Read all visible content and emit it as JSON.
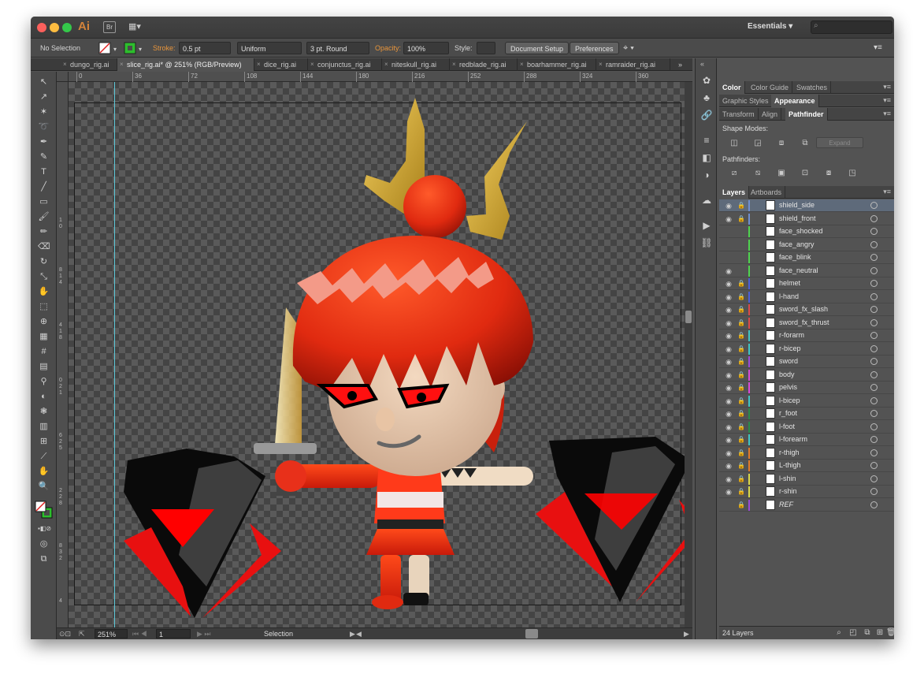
{
  "app": {
    "logo": "Ai",
    "bridge": "Br",
    "layout_icon": "▦▾",
    "workspace": "Essentials ▾",
    "search_placeholder": ""
  },
  "control": {
    "selection": "No Selection",
    "stroke_label": "Stroke:",
    "stroke_value": "0.5 pt",
    "uniform": "Uniform",
    "brush": "3 pt. Round",
    "opacity_label": "Opacity:",
    "opacity_value": "100%",
    "style_label": "Style:",
    "doc_setup": "Document Setup",
    "preferences": "Preferences"
  },
  "tabs": [
    {
      "label": "dungo_rig.ai",
      "active": false
    },
    {
      "label": "slice_rig.ai* @ 251% (RGB/Preview)",
      "active": true
    },
    {
      "label": "dice_rig.ai",
      "active": false
    },
    {
      "label": "conjunctus_rig.ai",
      "active": false
    },
    {
      "label": "niteskull_rig.ai",
      "active": false
    },
    {
      "label": "redblade_rig.ai",
      "active": false
    },
    {
      "label": "boarhammer_rig.ai",
      "active": false
    },
    {
      "label": "ramraider_rig.ai",
      "active": false
    }
  ],
  "ruler": {
    "h_ticks": [
      "0",
      "36",
      "72",
      "108",
      "144",
      "180",
      "216",
      "252",
      "288",
      "324",
      "360"
    ],
    "v_ticks": [
      "1",
      "0",
      "8",
      "1",
      "4",
      "4",
      "1",
      "8",
      "0",
      "2",
      "1",
      "6",
      "2",
      "5",
      "2",
      "2",
      "8",
      "8",
      "3",
      "2",
      "4"
    ]
  },
  "status": {
    "zoom": "251%",
    "page": "1",
    "mode": "Selection"
  },
  "panels": {
    "group1_tabs": [
      "Color",
      "Color Guide",
      "Swatches"
    ],
    "group2_tabs": [
      "Graphic Styles",
      "Appearance"
    ],
    "group3_tabs": [
      "Transform",
      "Align",
      "Pathfinder"
    ],
    "shape_modes": "Shape Modes:",
    "pathfinders": "Pathfinders:",
    "expand": "Expand",
    "layers_tabs": [
      "Layers",
      "Artboards"
    ],
    "layer_count": "24 Layers"
  },
  "layers": [
    {
      "name": "shield_side",
      "color": "#6f8fd0",
      "eye": true,
      "lock": true,
      "selected": true
    },
    {
      "name": "shield_front",
      "color": "#6f8fd0",
      "eye": true,
      "lock": true,
      "selected": false
    },
    {
      "name": "face_shocked",
      "color": "#4fd34f",
      "eye": false,
      "lock": false,
      "selected": false
    },
    {
      "name": "face_angry",
      "color": "#4fd34f",
      "eye": false,
      "lock": false,
      "selected": false
    },
    {
      "name": "face_blink",
      "color": "#4fd34f",
      "eye": false,
      "lock": false,
      "selected": false
    },
    {
      "name": "face_neutral",
      "color": "#4fd34f",
      "eye": true,
      "lock": false,
      "selected": false
    },
    {
      "name": "helmet",
      "color": "#4a5fd8",
      "eye": true,
      "lock": true,
      "selected": false
    },
    {
      "name": "l-hand",
      "color": "#4a5fd8",
      "eye": true,
      "lock": true,
      "selected": false
    },
    {
      "name": "sword_fx_slash",
      "color": "#d84a4a",
      "eye": true,
      "lock": true,
      "selected": false
    },
    {
      "name": "sword_fx_thrust",
      "color": "#d84a4a",
      "eye": true,
      "lock": true,
      "selected": false
    },
    {
      "name": "r-forarm",
      "color": "#3fc4c4",
      "eye": true,
      "lock": true,
      "selected": false
    },
    {
      "name": "r-bicep",
      "color": "#3fc4c4",
      "eye": true,
      "lock": true,
      "selected": false
    },
    {
      "name": "sword",
      "color": "#9a4ad8",
      "eye": true,
      "lock": true,
      "selected": false
    },
    {
      "name": "body",
      "color": "#d84ad8",
      "eye": true,
      "lock": true,
      "selected": false
    },
    {
      "name": "pelvis",
      "color": "#d84ad8",
      "eye": true,
      "lock": true,
      "selected": false
    },
    {
      "name": "l-bicep",
      "color": "#3fc4c4",
      "eye": true,
      "lock": true,
      "selected": false
    },
    {
      "name": "r_foot",
      "color": "#2a8a4a",
      "eye": true,
      "lock": true,
      "selected": false
    },
    {
      "name": "l-foot",
      "color": "#2a8a4a",
      "eye": true,
      "lock": true,
      "selected": false
    },
    {
      "name": "l-forearm",
      "color": "#3fc4c4",
      "eye": true,
      "lock": true,
      "selected": false
    },
    {
      "name": "r-thigh",
      "color": "#e07a2a",
      "eye": true,
      "lock": true,
      "selected": false
    },
    {
      "name": "L-thigh",
      "color": "#e07a2a",
      "eye": true,
      "lock": true,
      "selected": false
    },
    {
      "name": "l-shin",
      "color": "#d8d84a",
      "eye": true,
      "lock": true,
      "selected": false
    },
    {
      "name": "r-shin",
      "color": "#d8d84a",
      "eye": true,
      "lock": true,
      "selected": false
    },
    {
      "name": "REF",
      "color": "#9a4ad8",
      "eye": false,
      "lock": true,
      "selected": false,
      "italic": true
    }
  ],
  "colors": {
    "accent_orange": "#e8953b",
    "layer_selected": "#5e6a7a",
    "guide": "#5ec8d8"
  }
}
